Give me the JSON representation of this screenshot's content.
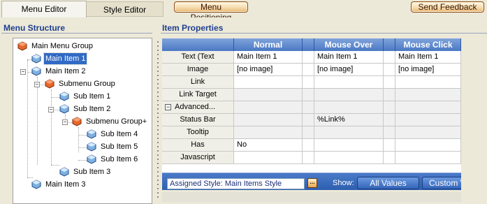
{
  "tabs": [
    {
      "label": "Menu Editor",
      "active": true
    },
    {
      "label": "Style Editor",
      "active": false
    }
  ],
  "toolbar": {
    "positioning_label": "Menu Positioning",
    "feedback_label": "Send Feedback"
  },
  "left": {
    "title": "Menu Structure",
    "tree": [
      {
        "label": "Main Menu Group",
        "icon": "group-cube-icon",
        "level": 0
      },
      {
        "label": "Main Item 1",
        "icon": "item-cube-icon",
        "level": 1,
        "selected": true
      },
      {
        "label": "Main Item 2",
        "icon": "item-cube-icon",
        "level": 1,
        "expander": "minus"
      },
      {
        "label": "Submenu Group",
        "icon": "group-cube-icon",
        "level": 2,
        "expander": "minus"
      },
      {
        "label": "Sub Item 1",
        "icon": "item-cube-icon",
        "level": 3
      },
      {
        "label": "Sub Item 2",
        "icon": "item-cube-icon",
        "level": 3,
        "expander": "minus"
      },
      {
        "label": "Submenu Group+",
        "icon": "group-cube-icon",
        "level": 4,
        "expander": "minus"
      },
      {
        "label": "Sub Item 4",
        "icon": "item-cube-icon",
        "level": 5
      },
      {
        "label": "Sub Item 5",
        "icon": "item-cube-icon",
        "level": 5
      },
      {
        "label": "Sub Item 6",
        "icon": "item-cube-icon",
        "level": 5
      },
      {
        "label": "Sub Item 3",
        "icon": "item-cube-icon",
        "level": 3
      },
      {
        "label": "Main Item 3",
        "icon": "item-cube-icon",
        "level": 1
      }
    ]
  },
  "right": {
    "title": "Item Properties",
    "columns": [
      "Normal",
      "Mouse Over",
      "Mouse Click"
    ],
    "rows": [
      {
        "label": "Text (Text",
        "values": [
          "Main Item 1",
          "Main Item 1",
          "Main Item 1"
        ],
        "style": "white"
      },
      {
        "label": "Image",
        "values": [
          "[no image]",
          "[no image]",
          "[no image]"
        ],
        "style": "white"
      },
      {
        "label": "Link",
        "values": [
          "",
          "",
          ""
        ],
        "style": "white"
      },
      {
        "label": "Link Target",
        "values": [
          "",
          "",
          ""
        ],
        "style": "gray"
      },
      {
        "label": "Advanced...",
        "values": [
          "",
          "",
          ""
        ],
        "style": "gray",
        "group": true
      },
      {
        "label": "Status Bar",
        "values": [
          "",
          "%Link%",
          ""
        ],
        "style": "gray"
      },
      {
        "label": "Tooltip",
        "values": [
          "",
          "",
          ""
        ],
        "style": "gray"
      },
      {
        "label": "Has",
        "values": [
          "No",
          "",
          ""
        ],
        "style": "white"
      },
      {
        "label": "Javascript",
        "values": [
          "",
          "",
          ""
        ],
        "style": "white"
      }
    ],
    "bottom": {
      "assigned_style": "Assigned Style: Main Items Style",
      "browse": "...",
      "show_label": "Show:",
      "all_values": "All Values",
      "custom_values": "Custom Values"
    }
  },
  "colors": {
    "accent": "#316ac5",
    "header_blue": "#4b78c4",
    "title_blue": "#1f3f8f",
    "pill_orange": "#e8b872"
  }
}
